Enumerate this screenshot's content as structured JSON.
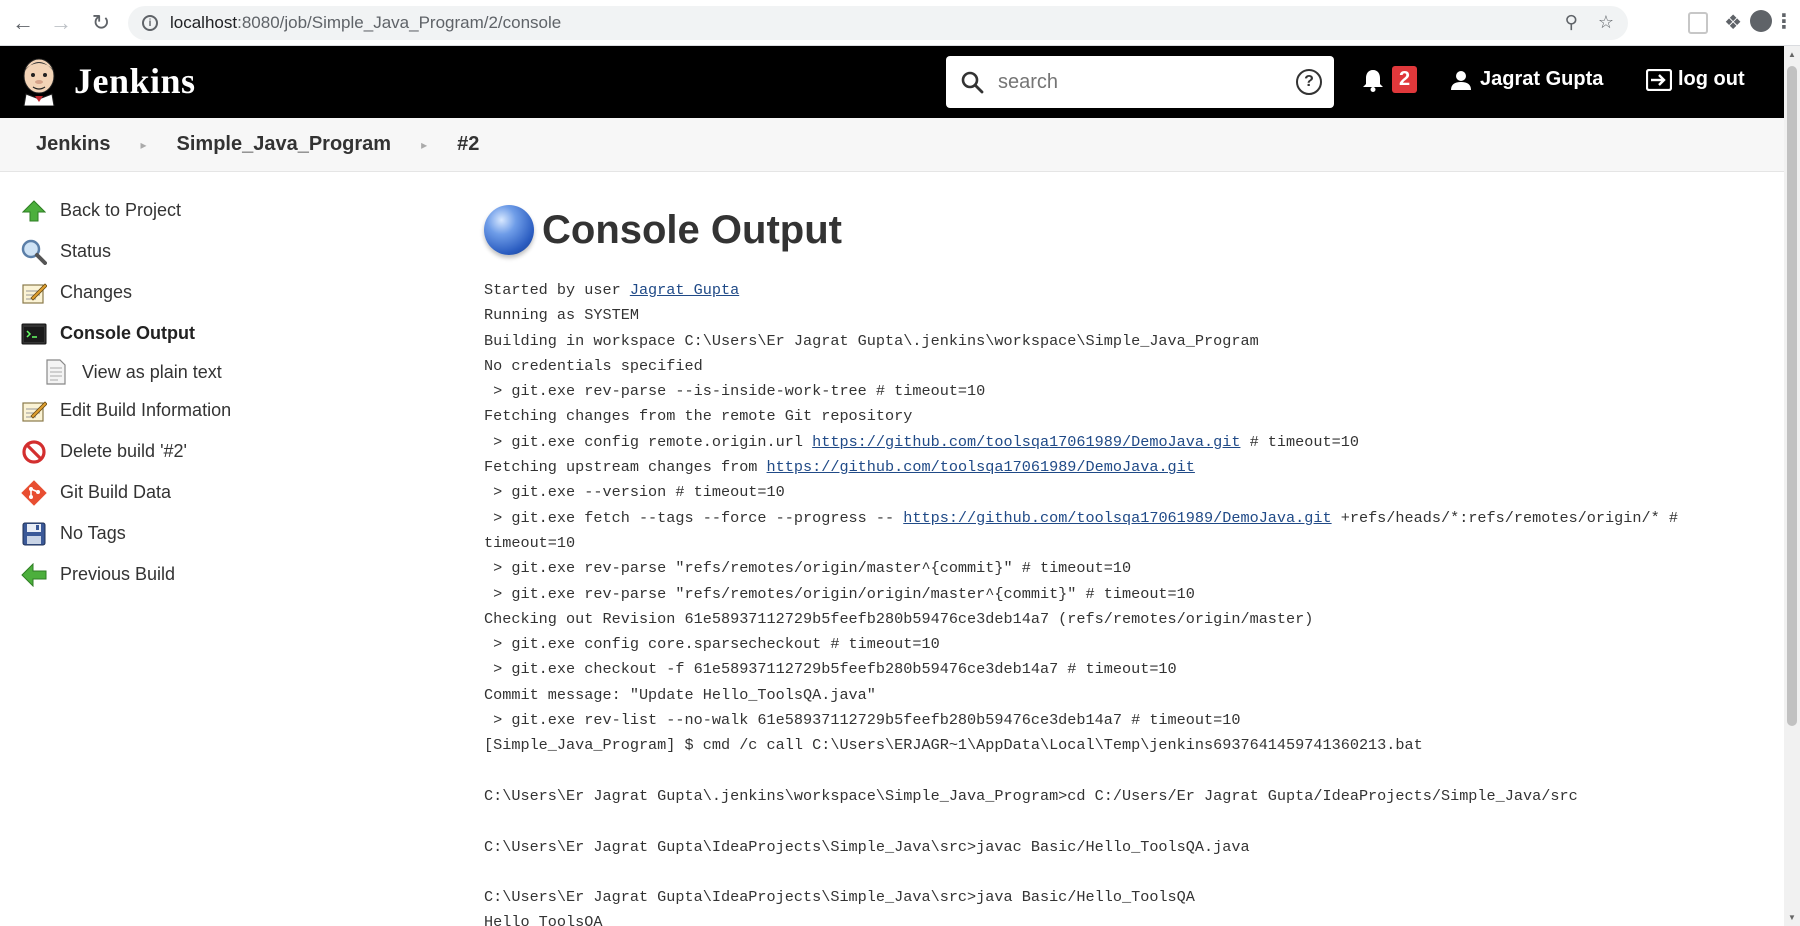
{
  "browser": {
    "url_host": "localhost",
    "url_path": ":8080/job/Simple_Java_Program/2/console"
  },
  "header": {
    "logo_text": "Jenkins",
    "search_placeholder": "search",
    "notification_count": "2",
    "user_name": "Jagrat Gupta",
    "logout_label": "log out"
  },
  "breadcrumb": [
    "Jenkins",
    "Simple_Java_Program",
    "#2"
  ],
  "side_panel": {
    "items": [
      {
        "label": "Back to Project",
        "icon": "up-arrow-icon"
      },
      {
        "label": "Status",
        "icon": "magnifier-icon"
      },
      {
        "label": "Changes",
        "icon": "notepad-icon"
      },
      {
        "label": "Console Output",
        "icon": "terminal-icon"
      },
      {
        "label": "View as plain text",
        "icon": "document-icon"
      },
      {
        "label": "Edit Build Information",
        "icon": "notepad-icon"
      },
      {
        "label": "Delete build '#2'",
        "icon": "no-entry-icon"
      },
      {
        "label": "Git Build Data",
        "icon": "git-icon"
      },
      {
        "label": "No Tags",
        "icon": "floppy-disk-icon"
      },
      {
        "label": "Previous Build",
        "icon": "left-arrow-icon"
      }
    ]
  },
  "main": {
    "title": "Console Output",
    "started_prefix": "Started by user ",
    "started_user": "Jagrat Gupta",
    "repo_url": "https://github.com/toolsqa17061989/DemoJava.git",
    "lines": {
      "l2": "Running as SYSTEM",
      "l3": "Building in workspace C:\\Users\\Er Jagrat Gupta\\.jenkins\\workspace\\Simple_Java_Program",
      "l4": "No credentials specified",
      "l5": " > git.exe rev-parse --is-inside-work-tree # timeout=10",
      "l6": "Fetching changes from the remote Git repository",
      "l7a": " > git.exe config remote.origin.url ",
      "l7b": " # timeout=10",
      "l8a": "Fetching upstream changes from ",
      "l9": " > git.exe --version # timeout=10",
      "l10a": " > git.exe fetch --tags --force --progress -- ",
      "l10b": " +refs/heads/*:refs/remotes/origin/* #",
      "l11": "timeout=10",
      "l12": " > git.exe rev-parse \"refs/remotes/origin/master^{commit}\" # timeout=10",
      "l13": " > git.exe rev-parse \"refs/remotes/origin/origin/master^{commit}\" # timeout=10",
      "l14": "Checking out Revision 61e58937112729b5feefb280b59476ce3deb14a7 (refs/remotes/origin/master)",
      "l15": " > git.exe config core.sparsecheckout # timeout=10",
      "l16": " > git.exe checkout -f 61e58937112729b5feefb280b59476ce3deb14a7 # timeout=10",
      "l17": "Commit message: \"Update Hello_ToolsQA.java\"",
      "l18": " > git.exe rev-list --no-walk 61e58937112729b5feefb280b59476ce3deb14a7 # timeout=10",
      "l19": "[Simple_Java_Program] $ cmd /c call C:\\Users\\ERJAGR~1\\AppData\\Local\\Temp\\jenkins6937641459741360213.bat",
      "l20": "",
      "l21": "C:\\Users\\Er Jagrat Gupta\\.jenkins\\workspace\\Simple_Java_Program>cd C:/Users/Er Jagrat Gupta/IdeaProjects/Simple_Java/src",
      "l22": "",
      "l23": "C:\\Users\\Er Jagrat Gupta\\IdeaProjects\\Simple_Java\\src>javac Basic/Hello_ToolsQA.java",
      "l24": "",
      "l25": "C:\\Users\\Er Jagrat Gupta\\IdeaProjects\\Simple_Java\\src>java Basic/Hello_ToolsQA",
      "l26": "Hello ToolsQA"
    }
  },
  "colors": {
    "header_bg": "#000000",
    "badge_bg": "#e0383b",
    "link": "#204a87"
  }
}
